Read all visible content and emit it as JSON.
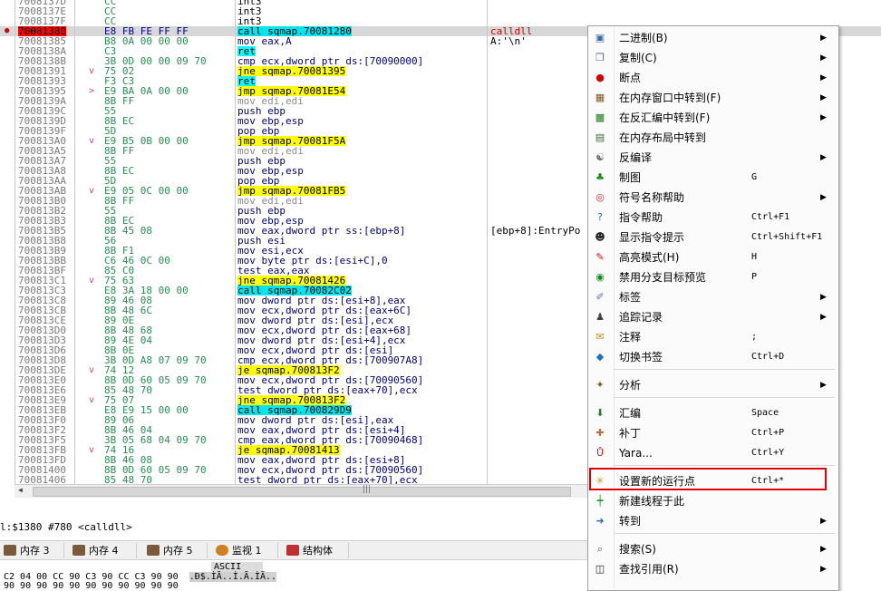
{
  "disasm": {
    "rows": [
      {
        "addr": "7008137D",
        "bytes": "CC",
        "instr": "int3",
        "kind": "int3",
        "arrow": "",
        "mark": "",
        "cmt": ""
      },
      {
        "addr": "7008137E",
        "bytes": "CC",
        "instr": "int3",
        "kind": "int3",
        "arrow": "",
        "mark": "",
        "cmt": ""
      },
      {
        "addr": "7008137F",
        "bytes": "CC",
        "instr": "int3",
        "kind": "int3",
        "arrow": "",
        "mark": "",
        "cmt": ""
      },
      {
        "addr": "70081380",
        "bytes": "E8 FB FE FF FF",
        "instr": "call sqmap.70081280",
        "kind": "call",
        "arrow": "",
        "mark": "●",
        "cmt": "calldll",
        "cur": true
      },
      {
        "addr": "70081385",
        "bytes": "B8 0A 00 00 00",
        "instr": "mov eax,A",
        "kind": "mov",
        "arrow": "",
        "mark": "",
        "cmt": "A:'\\n'"
      },
      {
        "addr": "7008138A",
        "bytes": "C3",
        "instr": "ret",
        "kind": "ret",
        "arrow": "",
        "mark": "",
        "cmt": ""
      },
      {
        "addr": "7008138B",
        "bytes": "3B 0D 00 00 09 70",
        "instr": "cmp ecx,dword ptr ds:[70090000]",
        "kind": "mov",
        "arrow": "",
        "mark": "",
        "cmt": ""
      },
      {
        "addr": "70081391",
        "bytes": "75 02",
        "instr": "jne sqmap.70081395",
        "kind": "jmp",
        "arrow": "v",
        "mark": "",
        "cmt": ""
      },
      {
        "addr": "70081393",
        "bytes": "F3 C3",
        "instr": "ret",
        "kind": "ret",
        "arrow": "",
        "mark": "",
        "cmt": ""
      },
      {
        "addr": "70081395",
        "bytes": "E9 BA 0A 00 00",
        "instr": "jmp sqmap.70081E54",
        "kind": "jmp",
        "arrow": ">",
        "mark": "",
        "cmt": ""
      },
      {
        "addr": "7008139A",
        "bytes": "8B FF",
        "instr": "mov edi,edi",
        "kind": "dim",
        "arrow": "",
        "mark": "",
        "cmt": ""
      },
      {
        "addr": "7008139C",
        "bytes": "55",
        "instr": "push ebp",
        "kind": "mov",
        "arrow": "",
        "mark": "",
        "cmt": ""
      },
      {
        "addr": "7008139D",
        "bytes": "8B EC",
        "instr": "mov ebp,esp",
        "kind": "mov",
        "arrow": "",
        "mark": "",
        "cmt": ""
      },
      {
        "addr": "7008139F",
        "bytes": "5D",
        "instr": "pop ebp",
        "kind": "mov",
        "arrow": "",
        "mark": "",
        "cmt": ""
      },
      {
        "addr": "700813A0",
        "bytes": "E9 B5 0B 00 00",
        "instr": "jmp sqmap.70081F5A",
        "kind": "jmp",
        "arrow": "v",
        "mark": "",
        "cmt": ""
      },
      {
        "addr": "700813A5",
        "bytes": "8B FF",
        "instr": "mov edi,edi",
        "kind": "dim",
        "arrow": "",
        "mark": "",
        "cmt": ""
      },
      {
        "addr": "700813A7",
        "bytes": "55",
        "instr": "push ebp",
        "kind": "mov",
        "arrow": "",
        "mark": "",
        "cmt": ""
      },
      {
        "addr": "700813A8",
        "bytes": "8B EC",
        "instr": "mov ebp,esp",
        "kind": "mov",
        "arrow": "",
        "mark": "",
        "cmt": ""
      },
      {
        "addr": "700813AA",
        "bytes": "5D",
        "instr": "pop ebp",
        "kind": "mov",
        "arrow": "",
        "mark": "",
        "cmt": ""
      },
      {
        "addr": "700813AB",
        "bytes": "E9 05 0C 00 00",
        "instr": "jmp sqmap.70081FB5",
        "kind": "jmp",
        "arrow": "v",
        "mark": "",
        "cmt": ""
      },
      {
        "addr": "700813B0",
        "bytes": "8B FF",
        "instr": "mov edi,edi",
        "kind": "dim",
        "arrow": "",
        "mark": "",
        "cmt": ""
      },
      {
        "addr": "700813B2",
        "bytes": "55",
        "instr": "push ebp",
        "kind": "mov",
        "arrow": "",
        "mark": "",
        "cmt": ""
      },
      {
        "addr": "700813B3",
        "bytes": "8B EC",
        "instr": "mov ebp,esp",
        "kind": "mov",
        "arrow": "",
        "mark": "",
        "cmt": ""
      },
      {
        "addr": "700813B5",
        "bytes": "8B 45 08",
        "instr": "mov eax,dword ptr ss:[ebp+8]",
        "kind": "mov",
        "arrow": "",
        "mark": "",
        "cmt": "[ebp+8]:EntryPo"
      },
      {
        "addr": "700813B8",
        "bytes": "56",
        "instr": "push esi",
        "kind": "mov",
        "arrow": "",
        "mark": "",
        "cmt": ""
      },
      {
        "addr": "700813B9",
        "bytes": "8B F1",
        "instr": "mov esi,ecx",
        "kind": "mov",
        "arrow": "",
        "mark": "",
        "cmt": ""
      },
      {
        "addr": "700813BB",
        "bytes": "C6 46 0C 00",
        "instr": "mov byte ptr ds:[esi+C],0",
        "kind": "mov",
        "arrow": "",
        "mark": "",
        "cmt": ""
      },
      {
        "addr": "700813BF",
        "bytes": "85 C0",
        "instr": "test eax,eax",
        "kind": "mov",
        "arrow": "",
        "mark": "",
        "cmt": ""
      },
      {
        "addr": "700813C1",
        "bytes": "75 63",
        "instr": "jne sqmap.70081426",
        "kind": "jmp",
        "arrow": "v",
        "mark": "",
        "cmt": ""
      },
      {
        "addr": "700813C3",
        "bytes": "E8 3A 18 00 00",
        "instr": "call sqmap.70082C02",
        "kind": "call",
        "arrow": "",
        "mark": "",
        "cmt": ""
      },
      {
        "addr": "700813C8",
        "bytes": "89 46 08",
        "instr": "mov dword ptr ds:[esi+8],eax",
        "kind": "mov",
        "arrow": "",
        "mark": "",
        "cmt": ""
      },
      {
        "addr": "700813CB",
        "bytes": "8B 48 6C",
        "instr": "mov ecx,dword ptr ds:[eax+6C]",
        "kind": "mov",
        "arrow": "",
        "mark": "",
        "cmt": ""
      },
      {
        "addr": "700813CE",
        "bytes": "89 0E",
        "instr": "mov dword ptr ds:[esi],ecx",
        "kind": "mov",
        "arrow": "",
        "mark": "",
        "cmt": ""
      },
      {
        "addr": "700813D0",
        "bytes": "8B 48 68",
        "instr": "mov ecx,dword ptr ds:[eax+68]",
        "kind": "mov",
        "arrow": "",
        "mark": "",
        "cmt": ""
      },
      {
        "addr": "700813D3",
        "bytes": "89 4E 04",
        "instr": "mov dword ptr ds:[esi+4],ecx",
        "kind": "mov",
        "arrow": "",
        "mark": "",
        "cmt": ""
      },
      {
        "addr": "700813D6",
        "bytes": "8B 0E",
        "instr": "mov ecx,dword ptr ds:[esi]",
        "kind": "mov",
        "arrow": "",
        "mark": "",
        "cmt": ""
      },
      {
        "addr": "700813D8",
        "bytes": "3B 0D A8 07 09 70",
        "instr": "cmp ecx,dword ptr ds:[700907A8]",
        "kind": "mov",
        "arrow": "",
        "mark": "",
        "cmt": ""
      },
      {
        "addr": "700813DE",
        "bytes": "74 12",
        "instr": "je sqmap.700813F2",
        "kind": "jmp",
        "arrow": "v",
        "mark": "",
        "cmt": ""
      },
      {
        "addr": "700813E0",
        "bytes": "8B 0D 60 05 09 70",
        "instr": "mov ecx,dword ptr ds:[70090560]",
        "kind": "mov",
        "arrow": "",
        "mark": "",
        "cmt": ""
      },
      {
        "addr": "700813E6",
        "bytes": "85 48 70",
        "instr": "test dword ptr ds:[eax+70],ecx",
        "kind": "mov",
        "arrow": "",
        "mark": "",
        "cmt": ""
      },
      {
        "addr": "700813E9",
        "bytes": "75 07",
        "instr": "jne sqmap.700813F2",
        "kind": "jmp",
        "arrow": "v",
        "mark": "",
        "cmt": ""
      },
      {
        "addr": "700813EB",
        "bytes": "E8 E9 15 00 00",
        "instr": "call sqmap.700829D9",
        "kind": "call",
        "arrow": "",
        "mark": "",
        "cmt": ""
      },
      {
        "addr": "700813F0",
        "bytes": "89 06",
        "instr": "mov dword ptr ds:[esi],eax",
        "kind": "mov",
        "arrow": "",
        "mark": "",
        "cmt": ""
      },
      {
        "addr": "700813F2",
        "bytes": "8B 46 04",
        "instr": "mov eax,dword ptr ds:[esi+4]",
        "kind": "mov",
        "arrow": "",
        "mark": "",
        "cmt": ""
      },
      {
        "addr": "700813F5",
        "bytes": "3B 05 68 04 09 70",
        "instr": "cmp eax,dword ptr ds:[70090468]",
        "kind": "mov",
        "arrow": "",
        "mark": "",
        "cmt": ""
      },
      {
        "addr": "700813FB",
        "bytes": "74 16",
        "instr": "je sqmap.70081413",
        "kind": "jmp",
        "arrow": "v",
        "mark": "",
        "cmt": ""
      },
      {
        "addr": "700813FD",
        "bytes": "8B 46 08",
        "instr": "mov eax,dword ptr ds:[esi+8]",
        "kind": "mov",
        "arrow": "",
        "mark": "",
        "cmt": ""
      },
      {
        "addr": "70081400",
        "bytes": "8B 0D 60 05 09 70",
        "instr": "mov ecx,dword ptr ds:[70090560]",
        "kind": "mov",
        "arrow": "",
        "mark": "",
        "cmt": ""
      },
      {
        "addr": "70081406",
        "bytes": "85 48 70",
        "instr": "test dword ptr ds:[eax+70],ecx",
        "kind": "mov",
        "arrow": "",
        "mark": "",
        "cmt": ""
      }
    ]
  },
  "scroll_grip": "|||",
  "status": {
    "text": "l:$1380 #780 <calldll>"
  },
  "tabs": [
    {
      "label": "内存 3"
    },
    {
      "label": "内存 4"
    },
    {
      "label": "内存 5"
    },
    {
      "label": "监视 1"
    },
    {
      "label": "结构体"
    }
  ],
  "hex": {
    "header": "ASCII",
    "row_hex": "C2 04 00 CC 90 C3 90 CC C3 90 90",
    "row_ascii": ".Ð$.ÌÃ..Ì.Ã.ÌÃ..",
    "row2": "90 90 90 90 90 90 90 90 90 90 90"
  },
  "menu": {
    "items": [
      {
        "label": "二进制(B)",
        "shortcut": "",
        "sub": true,
        "icon": "binary-icon",
        "glyph": "▣",
        "color": "#3a6ea5"
      },
      {
        "label": "复制(C)",
        "shortcut": "",
        "sub": true,
        "icon": "copy-icon",
        "glyph": "❐",
        "color": "#4a6ea5"
      },
      {
        "label": "断点",
        "shortcut": "",
        "sub": true,
        "icon": "breakpoint-icon",
        "glyph": "●",
        "color": "#d00000"
      },
      {
        "label": "在内存窗口中转到(F)",
        "shortcut": "",
        "sub": true,
        "icon": "memory-window-icon",
        "glyph": "▦",
        "color": "#7a5a20"
      },
      {
        "label": "在反汇编中转到(F)",
        "shortcut": "",
        "sub": true,
        "icon": "disassembly-icon",
        "glyph": "▩",
        "color": "#1e7a1e"
      },
      {
        "label": "在内存布局中转到",
        "shortcut": "",
        "sub": false,
        "icon": "memory-map-icon",
        "glyph": "▤",
        "color": "#3a6a3a"
      },
      {
        "label": "反编译",
        "shortcut": "",
        "sub": true,
        "icon": "decompile-icon",
        "glyph": "☯",
        "color": "#707070"
      },
      {
        "label": "制图",
        "shortcut": "G",
        "sub": false,
        "icon": "graph-icon",
        "glyph": "♣",
        "color": "#1e8a1e"
      },
      {
        "label": "符号名称帮助",
        "shortcut": "",
        "sub": true,
        "icon": "lifebuoy-icon",
        "glyph": "◎",
        "color": "#d03030"
      },
      {
        "label": "指令帮助",
        "shortcut": "Ctrl+F1",
        "sub": false,
        "icon": "help-icon",
        "glyph": "?",
        "color": "#2a5fb0"
      },
      {
        "label": "显示指令提示",
        "shortcut": "Ctrl+Shift+F1",
        "sub": false,
        "icon": "penguin-icon",
        "glyph": "☻",
        "color": "#202020"
      },
      {
        "label": "高亮模式(H)",
        "shortcut": "H",
        "sub": false,
        "icon": "highlighter-icon",
        "glyph": "✎",
        "color": "#d01010"
      },
      {
        "label": "禁用分支目标预览",
        "shortcut": "P",
        "sub": false,
        "icon": "preview-icon",
        "glyph": "◉",
        "color": "#1a8a1a"
      },
      {
        "label": "标签",
        "shortcut": "",
        "sub": true,
        "icon": "label-icon",
        "glyph": "✐",
        "color": "#5a70a0"
      },
      {
        "label": "追踪记录",
        "shortcut": "",
        "sub": true,
        "icon": "footprint-icon",
        "glyph": "♟",
        "color": "#404040"
      },
      {
        "label": "注释",
        "shortcut": ";",
        "sub": false,
        "icon": "comment-icon",
        "glyph": "✉",
        "color": "#c09020"
      },
      {
        "label": "切换书签",
        "shortcut": "Ctrl+D",
        "sub": false,
        "icon": "bookmark-icon",
        "glyph": "◆",
        "color": "#2070c0"
      },
      {
        "label": "分析",
        "shortcut": "",
        "sub": true,
        "icon": "analysis-icon",
        "glyph": "✦",
        "color": "#806020"
      },
      {
        "label": "汇编",
        "shortcut": "Space",
        "sub": false,
        "icon": "assemble-icon",
        "glyph": "⬇",
        "color": "#2a7a2a"
      },
      {
        "label": "补丁",
        "shortcut": "Ctrl+P",
        "sub": false,
        "icon": "patch-icon",
        "glyph": "✚",
        "color": "#c0703a"
      },
      {
        "label": "Yara...",
        "shortcut": "Ctrl+Y",
        "sub": false,
        "icon": "yara-icon",
        "glyph": "Ů",
        "color": "#c02020"
      },
      {
        "label": "设置新的运行点",
        "shortcut": "Ctrl+*",
        "sub": false,
        "icon": "set-origin-icon",
        "glyph": "✳",
        "color": "#c0a020"
      },
      {
        "label": "新建线程于此",
        "shortcut": "",
        "sub": false,
        "icon": "new-thread-icon",
        "glyph": "┿",
        "color": "#20a020"
      },
      {
        "label": "转到",
        "shortcut": "",
        "sub": true,
        "icon": "goto-icon",
        "glyph": "➜",
        "color": "#2a6ab0"
      },
      {
        "label": "搜索(S)",
        "shortcut": "",
        "sub": true,
        "icon": "search-icon",
        "glyph": "⌕",
        "color": "#505050"
      },
      {
        "label": "查找引用(R)",
        "shortcut": "",
        "sub": true,
        "icon": "find-references-icon",
        "glyph": "◫",
        "color": "#202020"
      }
    ],
    "submenu_glyph": "▶"
  }
}
